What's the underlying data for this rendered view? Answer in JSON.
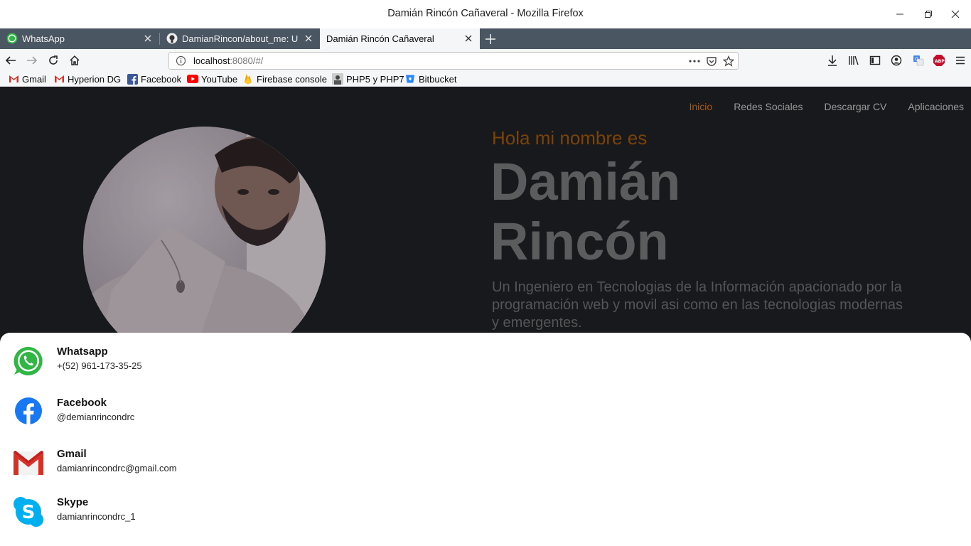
{
  "window": {
    "title": "Damián Rincón Cañaveral - Mozilla Firefox"
  },
  "tabs": [
    {
      "label": "WhatsApp",
      "icon": "whatsapp-icon",
      "active": false
    },
    {
      "label": "DamianRincon/about_me: Un",
      "icon": "github-icon",
      "active": false
    },
    {
      "label": "Damián Rincón Cañaveral",
      "icon": "",
      "active": true
    }
  ],
  "url": {
    "host": "localhost",
    "rest": ":8080/#/"
  },
  "bookmarks": [
    {
      "label": "Gmail",
      "icon": "gmail-icon"
    },
    {
      "label": "Hyperion DG",
      "icon": "gmail-icon"
    },
    {
      "label": "Facebook",
      "icon": "facebook-icon"
    },
    {
      "label": "YouTube",
      "icon": "youtube-icon"
    },
    {
      "label": "Firebase console",
      "icon": "firebase-icon"
    },
    {
      "label": "PHP5 y PHP7",
      "icon": "php-icon"
    },
    {
      "label": "Bitbucket",
      "icon": "bitbucket-icon"
    }
  ],
  "site": {
    "nav": [
      {
        "label": "Inicio",
        "active": true
      },
      {
        "label": "Redes Sociales",
        "active": false
      },
      {
        "label": "Descargar CV",
        "active": false
      },
      {
        "label": "Aplicaciones",
        "active": false
      }
    ],
    "greeting": "Hola mi nombre es",
    "name_line1": "Damián",
    "name_line2": "Rincón",
    "description": "Un Ingeniero en Tecnologias de la Información apacionado por la programación web y movil asi como en las tecnologias modernas y emergentes.",
    "accent_color": "#a85b09"
  },
  "contacts": [
    {
      "name": "Whatsapp",
      "value": "+(52) 961-173-35-25",
      "icon": "whatsapp-icon"
    },
    {
      "name": "Facebook",
      "value": "@demianrincondrc",
      "icon": "facebook-icon"
    },
    {
      "name": "Gmail",
      "value": "damianrincondrc@gmail.com",
      "icon": "gmail-icon"
    },
    {
      "name": "Skype",
      "value": "damianrincondrc_1",
      "icon": "skype-icon"
    }
  ]
}
